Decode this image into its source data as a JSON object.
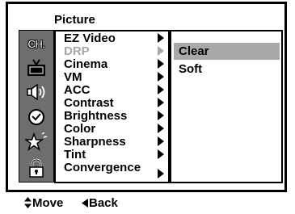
{
  "menu": {
    "title": "Picture",
    "items": [
      {
        "label": "EZ Video",
        "enabled": true
      },
      {
        "label": "DRP",
        "enabled": false
      },
      {
        "label": "Cinema",
        "enabled": true
      },
      {
        "label": "VM",
        "enabled": true
      },
      {
        "label": "ACC",
        "enabled": true
      },
      {
        "label": "Contrast",
        "enabled": true
      },
      {
        "label": "Brightness",
        "enabled": true
      },
      {
        "label": "Color",
        "enabled": true
      },
      {
        "label": "Sharpness",
        "enabled": true
      },
      {
        "label": "Tint",
        "enabled": true
      },
      {
        "label": "Convergence",
        "enabled": true
      }
    ]
  },
  "submenu": {
    "items": [
      {
        "label": "Clear",
        "selected": true
      },
      {
        "label": "Soft",
        "selected": false
      }
    ]
  },
  "icons": [
    {
      "name": "channel-icon",
      "label": "CH."
    },
    {
      "name": "tv-icon"
    },
    {
      "name": "sound-icon"
    },
    {
      "name": "clock-icon"
    },
    {
      "name": "setup-icon"
    },
    {
      "name": "lock-icon"
    }
  ],
  "hints": {
    "move": "Move",
    "back": "Back"
  },
  "colors": {
    "selection": "#a9a9a9",
    "disabled_text": "#a6a6a6",
    "icon_strip": "#6e6e6e"
  }
}
